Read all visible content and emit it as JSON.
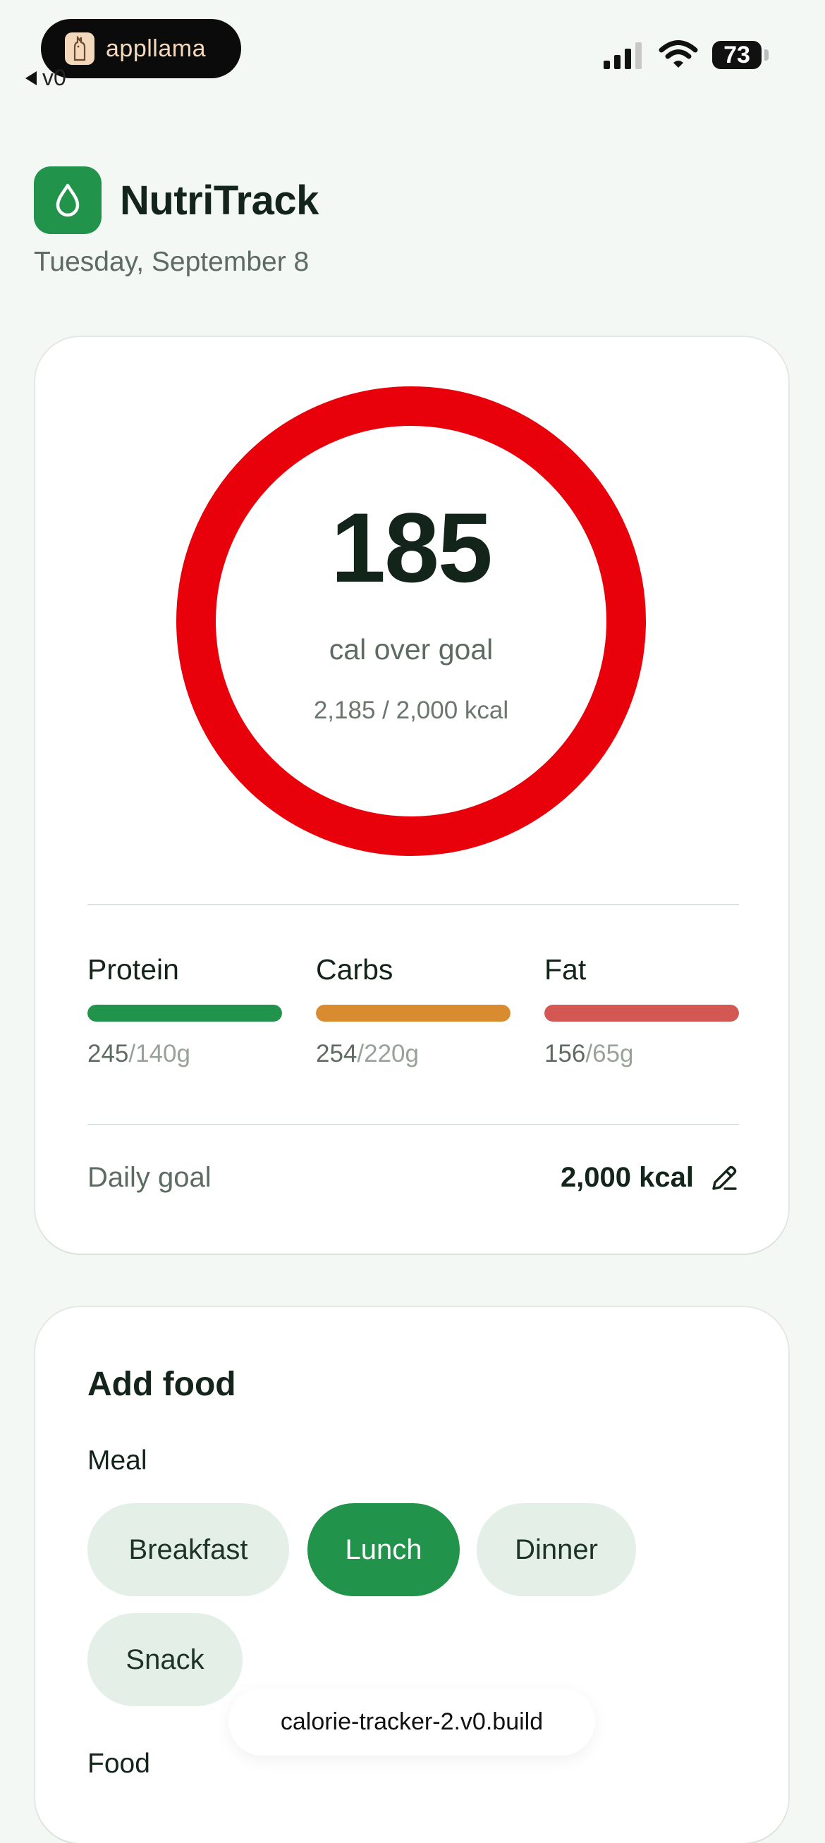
{
  "status_bar": {
    "brand": "appllama",
    "back_label": "v0",
    "battery": "73"
  },
  "header": {
    "title": "NutriTrack",
    "date": "Tuesday, September 8"
  },
  "summary": {
    "value": "185",
    "label": "cal over goal",
    "consumed_text": "2,185 / 2,000 kcal",
    "ring_fraction": 1.0,
    "ring_color": "#e8000b",
    "macros": [
      {
        "label": "Protein",
        "current": "245",
        "goal": "/140g",
        "fill": 1.0,
        "color": "#22934a"
      },
      {
        "label": "Carbs",
        "current": "254",
        "goal": "/220g",
        "fill": 1.0,
        "color": "#d98b2f"
      },
      {
        "label": "Fat",
        "current": "156",
        "goal": "/65g",
        "fill": 1.0,
        "color": "#d35752"
      }
    ],
    "daily_goal_label": "Daily goal",
    "daily_goal_value": "2,000 kcal"
  },
  "add_food": {
    "title": "Add food",
    "meal_label": "Meal",
    "meals": [
      "Breakfast",
      "Lunch",
      "Dinner",
      "Snack"
    ],
    "selected_meal": "Lunch",
    "food_label": "Food"
  },
  "toast": "calorie-tracker-2.v0.build",
  "colors": {
    "accent": "#22934a",
    "background": "#f3f8f4",
    "over_goal": "#e8000b"
  }
}
